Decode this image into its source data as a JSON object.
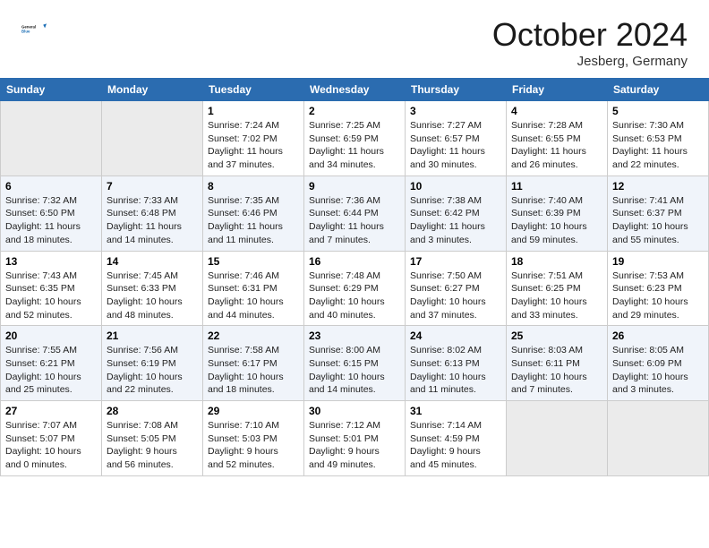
{
  "header": {
    "logo_line1": "General",
    "logo_line2": "Blue",
    "month": "October 2024",
    "location": "Jesberg, Germany"
  },
  "weekdays": [
    "Sunday",
    "Monday",
    "Tuesday",
    "Wednesday",
    "Thursday",
    "Friday",
    "Saturday"
  ],
  "weeks": [
    [
      {
        "day": "",
        "info": ""
      },
      {
        "day": "",
        "info": ""
      },
      {
        "day": "1",
        "info": "Sunrise: 7:24 AM\nSunset: 7:02 PM\nDaylight: 11 hours\nand 37 minutes."
      },
      {
        "day": "2",
        "info": "Sunrise: 7:25 AM\nSunset: 6:59 PM\nDaylight: 11 hours\nand 34 minutes."
      },
      {
        "day": "3",
        "info": "Sunrise: 7:27 AM\nSunset: 6:57 PM\nDaylight: 11 hours\nand 30 minutes."
      },
      {
        "day": "4",
        "info": "Sunrise: 7:28 AM\nSunset: 6:55 PM\nDaylight: 11 hours\nand 26 minutes."
      },
      {
        "day": "5",
        "info": "Sunrise: 7:30 AM\nSunset: 6:53 PM\nDaylight: 11 hours\nand 22 minutes."
      }
    ],
    [
      {
        "day": "6",
        "info": "Sunrise: 7:32 AM\nSunset: 6:50 PM\nDaylight: 11 hours\nand 18 minutes."
      },
      {
        "day": "7",
        "info": "Sunrise: 7:33 AM\nSunset: 6:48 PM\nDaylight: 11 hours\nand 14 minutes."
      },
      {
        "day": "8",
        "info": "Sunrise: 7:35 AM\nSunset: 6:46 PM\nDaylight: 11 hours\nand 11 minutes."
      },
      {
        "day": "9",
        "info": "Sunrise: 7:36 AM\nSunset: 6:44 PM\nDaylight: 11 hours\nand 7 minutes."
      },
      {
        "day": "10",
        "info": "Sunrise: 7:38 AM\nSunset: 6:42 PM\nDaylight: 11 hours\nand 3 minutes."
      },
      {
        "day": "11",
        "info": "Sunrise: 7:40 AM\nSunset: 6:39 PM\nDaylight: 10 hours\nand 59 minutes."
      },
      {
        "day": "12",
        "info": "Sunrise: 7:41 AM\nSunset: 6:37 PM\nDaylight: 10 hours\nand 55 minutes."
      }
    ],
    [
      {
        "day": "13",
        "info": "Sunrise: 7:43 AM\nSunset: 6:35 PM\nDaylight: 10 hours\nand 52 minutes."
      },
      {
        "day": "14",
        "info": "Sunrise: 7:45 AM\nSunset: 6:33 PM\nDaylight: 10 hours\nand 48 minutes."
      },
      {
        "day": "15",
        "info": "Sunrise: 7:46 AM\nSunset: 6:31 PM\nDaylight: 10 hours\nand 44 minutes."
      },
      {
        "day": "16",
        "info": "Sunrise: 7:48 AM\nSunset: 6:29 PM\nDaylight: 10 hours\nand 40 minutes."
      },
      {
        "day": "17",
        "info": "Sunrise: 7:50 AM\nSunset: 6:27 PM\nDaylight: 10 hours\nand 37 minutes."
      },
      {
        "day": "18",
        "info": "Sunrise: 7:51 AM\nSunset: 6:25 PM\nDaylight: 10 hours\nand 33 minutes."
      },
      {
        "day": "19",
        "info": "Sunrise: 7:53 AM\nSunset: 6:23 PM\nDaylight: 10 hours\nand 29 minutes."
      }
    ],
    [
      {
        "day": "20",
        "info": "Sunrise: 7:55 AM\nSunset: 6:21 PM\nDaylight: 10 hours\nand 25 minutes."
      },
      {
        "day": "21",
        "info": "Sunrise: 7:56 AM\nSunset: 6:19 PM\nDaylight: 10 hours\nand 22 minutes."
      },
      {
        "day": "22",
        "info": "Sunrise: 7:58 AM\nSunset: 6:17 PM\nDaylight: 10 hours\nand 18 minutes."
      },
      {
        "day": "23",
        "info": "Sunrise: 8:00 AM\nSunset: 6:15 PM\nDaylight: 10 hours\nand 14 minutes."
      },
      {
        "day": "24",
        "info": "Sunrise: 8:02 AM\nSunset: 6:13 PM\nDaylight: 10 hours\nand 11 minutes."
      },
      {
        "day": "25",
        "info": "Sunrise: 8:03 AM\nSunset: 6:11 PM\nDaylight: 10 hours\nand 7 minutes."
      },
      {
        "day": "26",
        "info": "Sunrise: 8:05 AM\nSunset: 6:09 PM\nDaylight: 10 hours\nand 3 minutes."
      }
    ],
    [
      {
        "day": "27",
        "info": "Sunrise: 7:07 AM\nSunset: 5:07 PM\nDaylight: 10 hours\nand 0 minutes."
      },
      {
        "day": "28",
        "info": "Sunrise: 7:08 AM\nSunset: 5:05 PM\nDaylight: 9 hours\nand 56 minutes."
      },
      {
        "day": "29",
        "info": "Sunrise: 7:10 AM\nSunset: 5:03 PM\nDaylight: 9 hours\nand 52 minutes."
      },
      {
        "day": "30",
        "info": "Sunrise: 7:12 AM\nSunset: 5:01 PM\nDaylight: 9 hours\nand 49 minutes."
      },
      {
        "day": "31",
        "info": "Sunrise: 7:14 AM\nSunset: 4:59 PM\nDaylight: 9 hours\nand 45 minutes."
      },
      {
        "day": "",
        "info": ""
      },
      {
        "day": "",
        "info": ""
      }
    ]
  ]
}
